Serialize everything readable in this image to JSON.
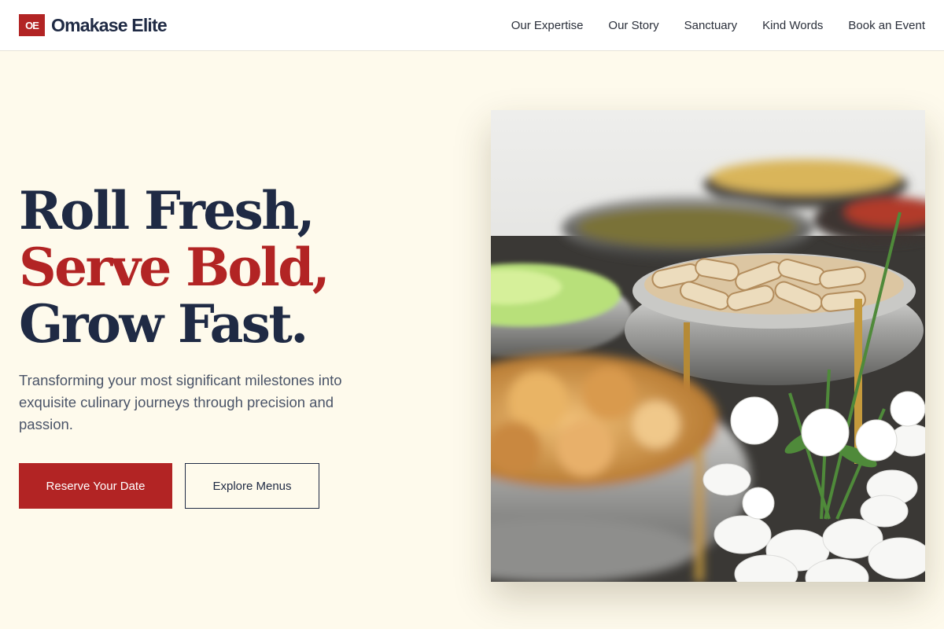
{
  "brand": {
    "badge": "OE",
    "name": "Omakase Elite"
  },
  "nav": {
    "items": [
      {
        "label": "Our Expertise"
      },
      {
        "label": "Our Story"
      },
      {
        "label": "Sanctuary"
      },
      {
        "label": "Kind Words"
      },
      {
        "label": "Book an Event"
      }
    ]
  },
  "hero": {
    "headline_line1": "Roll Fresh,",
    "headline_line2": "Serve Bold,",
    "headline_line3": "Grow Fast.",
    "subtitle": "Transforming your most significant milestones into exquisite culinary journeys through precision and passion.",
    "primary_cta": "Reserve Your Date",
    "secondary_cta": "Explore Menus"
  },
  "colors": {
    "brand_red": "#b22424",
    "navy": "#1f2a44",
    "cream_background": "#fefaec"
  }
}
